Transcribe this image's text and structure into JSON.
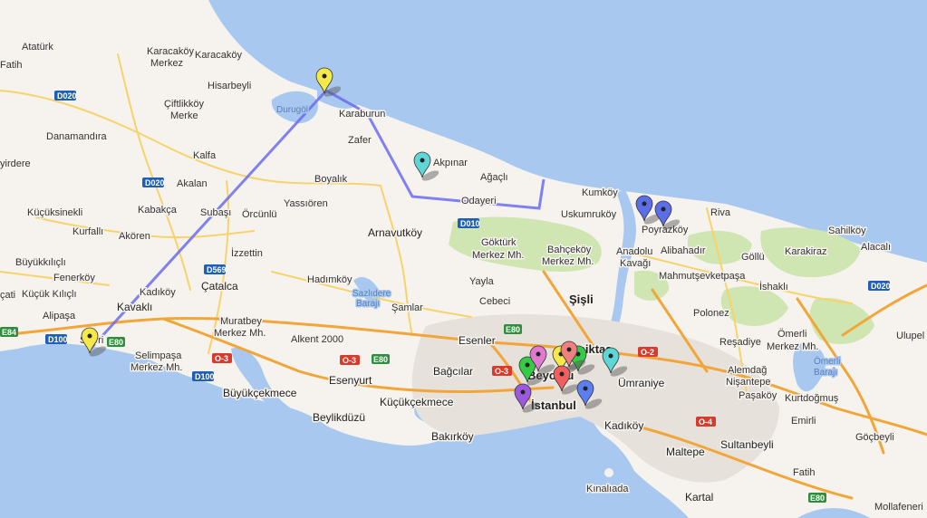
{
  "map": {
    "colors": {
      "sea": "#a8c8f0",
      "land": "#f6f3ee",
      "park": "#cfe6b2",
      "urban": "#e6e1da",
      "route": "#6b6bf0"
    },
    "labels": [
      {
        "id": "ataturk",
        "text": "Atatürk"
      },
      {
        "id": "fatih-w",
        "text": "Fatih"
      },
      {
        "id": "karacakoy-merkez-1",
        "text": "Karacaköy"
      },
      {
        "id": "karacakoy-merkez-2",
        "text": "Merkez"
      },
      {
        "id": "karacakoy",
        "text": "Karacaköy"
      },
      {
        "id": "hisarbeyli",
        "text": "Hisarbeyli"
      },
      {
        "id": "ciftlikkoy-1",
        "text": "Çiftlikköy"
      },
      {
        "id": "ciftlikkoy-2",
        "text": "Merke"
      },
      {
        "id": "durugol",
        "text": "Durugöl"
      },
      {
        "id": "karaburun",
        "text": "Karaburun"
      },
      {
        "id": "zafer",
        "text": "Zafer"
      },
      {
        "id": "danamandira",
        "text": "Danamandıra"
      },
      {
        "id": "yirdere",
        "text": "yirdere"
      },
      {
        "id": "kalfa",
        "text": "Kalfa"
      },
      {
        "id": "boyalik",
        "text": "Boyalık"
      },
      {
        "id": "akpinar",
        "text": "Akpınar"
      },
      {
        "id": "agacli",
        "text": "Ağaçlı"
      },
      {
        "id": "akalan",
        "text": "Akalan"
      },
      {
        "id": "odayeri",
        "text": "Odayeri"
      },
      {
        "id": "kumkoy",
        "text": "Kumköy"
      },
      {
        "id": "kucuksinekli",
        "text": "Küçüksinekli"
      },
      {
        "id": "kabakca",
        "text": "Kabakça"
      },
      {
        "id": "subasi",
        "text": "Subaşı"
      },
      {
        "id": "orcunlu",
        "text": "Örcünlü"
      },
      {
        "id": "yassioren",
        "text": "Yassıören"
      },
      {
        "id": "uskumrukoy",
        "text": "Uskumruköy"
      },
      {
        "id": "poyrazkoy",
        "text": "Poyrazköy"
      },
      {
        "id": "riva",
        "text": "Riva"
      },
      {
        "id": "kurfalli",
        "text": "Kurfallı"
      },
      {
        "id": "akoren",
        "text": "Akören"
      },
      {
        "id": "arnavutkoy",
        "text": "Arnavutköy"
      },
      {
        "id": "gokturk-1",
        "text": "Göktürk"
      },
      {
        "id": "gokturk-2",
        "text": "Merkez Mh."
      },
      {
        "id": "bahcekoy-1",
        "text": "Bahçeköy"
      },
      {
        "id": "bahcekoy-2",
        "text": "Merkez Mh."
      },
      {
        "id": "anadolu-1",
        "text": "Anadolu"
      },
      {
        "id": "anadolu-2",
        "text": "Kavağı"
      },
      {
        "id": "alibahadir",
        "text": "Alibahadır"
      },
      {
        "id": "gollu",
        "text": "Göllü"
      },
      {
        "id": "karakiraz",
        "text": "Karakiraz"
      },
      {
        "id": "sahilkoy",
        "text": "Sahilköy"
      },
      {
        "id": "alacali",
        "text": "Alacalı"
      },
      {
        "id": "izzettin",
        "text": "İzzettin"
      },
      {
        "id": "buyukkilicli",
        "text": "Büyükkılıçlı"
      },
      {
        "id": "fenerkoy",
        "text": "Fenerköy"
      },
      {
        "id": "mahmutsevketpasa",
        "text": "Mahmutşevketpaşa"
      },
      {
        "id": "ishakli",
        "text": "İshaklı"
      },
      {
        "id": "hadimkoy",
        "text": "Hadımköy"
      },
      {
        "id": "yayla",
        "text": "Yayla"
      },
      {
        "id": "sisli",
        "text": "Şişli"
      },
      {
        "id": "kucuk-kilicli",
        "text": "Küçük Kılıçlı"
      },
      {
        "id": "cati",
        "text": "çati"
      },
      {
        "id": "kadikoy-w",
        "text": "Kadıköy"
      },
      {
        "id": "catalca",
        "text": "Çatalca"
      },
      {
        "id": "sazlidere-1",
        "text": "Sazlıdere"
      },
      {
        "id": "sazlidere-2",
        "text": "Barajı"
      },
      {
        "id": "samlar",
        "text": "Şamlar"
      },
      {
        "id": "cebeci",
        "text": "Cebeci"
      },
      {
        "id": "polonez",
        "text": "Polonez"
      },
      {
        "id": "kavakli",
        "text": "Kavaklı"
      },
      {
        "id": "alipasa",
        "text": "Alipaşa"
      },
      {
        "id": "muratbey-1",
        "text": "Muratbey"
      },
      {
        "id": "muratbey-2",
        "text": "Merkez Mh."
      },
      {
        "id": "omerli-1",
        "text": "Ömerli"
      },
      {
        "id": "omerli-2",
        "text": "Merkez Mh."
      },
      {
        "id": "ulupel",
        "text": "Ulupel"
      },
      {
        "id": "silivri",
        "text": "Silivri"
      },
      {
        "id": "alkent",
        "text": "Alkent 2000"
      },
      {
        "id": "esenler",
        "text": "Esenler"
      },
      {
        "id": "besiktas",
        "text": "Beşiktaş"
      },
      {
        "id": "resadiye",
        "text": "Reşadiye"
      },
      {
        "id": "selimpasa-1",
        "text": "Selimpaşa"
      },
      {
        "id": "selimpasa-2",
        "text": "Merkez Mh."
      },
      {
        "id": "bagcilar",
        "text": "Bağcılar"
      },
      {
        "id": "beyoglu",
        "text": "Beyoğlu"
      },
      {
        "id": "umraniye",
        "text": "Ümraniye"
      },
      {
        "id": "alemdag-1",
        "text": "Alemdağ"
      },
      {
        "id": "alemdag-2",
        "text": "Nişantepe"
      },
      {
        "id": "omerli-baraji-1",
        "text": "Ömerli"
      },
      {
        "id": "omerli-baraji-2",
        "text": "Barajı"
      },
      {
        "id": "esenyurt",
        "text": "Esenyurt"
      },
      {
        "id": "buyukcekmece",
        "text": "Büyükçekmece"
      },
      {
        "id": "pasakoy",
        "text": "Paşaköy"
      },
      {
        "id": "kurtdogmus",
        "text": "Kurtdoğmuş"
      },
      {
        "id": "kucukcekmece",
        "text": "Küçükçekmece"
      },
      {
        "id": "istanbul",
        "text": "İstanbul"
      },
      {
        "id": "beylikduzu",
        "text": "Beylikdüzü"
      },
      {
        "id": "kadikoy",
        "text": "Kadıköy"
      },
      {
        "id": "emirli",
        "text": "Emirli"
      },
      {
        "id": "sultanbeyli",
        "text": "Sultanbeyli"
      },
      {
        "id": "gocbeyli",
        "text": "Göçbeyli"
      },
      {
        "id": "maltepe",
        "text": "Maltepe"
      },
      {
        "id": "bakirkoy",
        "text": "Bakırköy"
      },
      {
        "id": "fatih-e",
        "text": "Fatih"
      },
      {
        "id": "kinaliada",
        "text": "Kınalıada"
      },
      {
        "id": "kartal",
        "text": "Kartal"
      },
      {
        "id": "mollafener",
        "text": "Mollafeneri"
      }
    ],
    "shields": [
      {
        "id": "d020-a",
        "text": "D020",
        "kind": "blue"
      },
      {
        "id": "d020-b",
        "text": "D020",
        "kind": "blue"
      },
      {
        "id": "d010",
        "text": "D010",
        "kind": "blue"
      },
      {
        "id": "d569",
        "text": "D569",
        "kind": "blue"
      },
      {
        "id": "e84",
        "text": "E84",
        "kind": "green"
      },
      {
        "id": "d100-a",
        "text": "D100",
        "kind": "blue"
      },
      {
        "id": "e80-a",
        "text": "E80",
        "kind": "green"
      },
      {
        "id": "o3-a",
        "text": "O-3",
        "kind": "red"
      },
      {
        "id": "d100-b",
        "text": "D100",
        "kind": "blue"
      },
      {
        "id": "o3-b",
        "text": "O-3",
        "kind": "red"
      },
      {
        "id": "e80-b",
        "text": "E80",
        "kind": "green"
      },
      {
        "id": "e80-c",
        "text": "E80",
        "kind": "green"
      },
      {
        "id": "o3-c",
        "text": "O-3",
        "kind": "red"
      },
      {
        "id": "o2",
        "text": "O-2",
        "kind": "red"
      },
      {
        "id": "o4",
        "text": "O-4",
        "kind": "red"
      },
      {
        "id": "e80-d",
        "text": "E80",
        "kind": "green"
      },
      {
        "id": "d020-c",
        "text": "D020",
        "kind": "blue"
      }
    ],
    "markers": [
      {
        "id": "marker-yellow-karaburun",
        "color": "#f5e94a"
      },
      {
        "id": "marker-yellow-silivri",
        "color": "#f5e94a"
      },
      {
        "id": "marker-cyan-akpinar",
        "color": "#5fd6d6"
      },
      {
        "id": "marker-blue-poyrazkoy-1",
        "color": "#5b6ee8"
      },
      {
        "id": "marker-blue-poyrazkoy-2",
        "color": "#5b6ee8"
      },
      {
        "id": "marker-green-beyoglu",
        "color": "#33cc44"
      },
      {
        "id": "marker-pink-beyoglu",
        "color": "#e07ad0"
      },
      {
        "id": "marker-yellow-besiktas",
        "color": "#f5e94a"
      },
      {
        "id": "marker-green-besiktas",
        "color": "#33cc44"
      },
      {
        "id": "marker-red-besiktas",
        "color": "#f08080"
      },
      {
        "id": "marker-red-istanbul",
        "color": "#f06060"
      },
      {
        "id": "marker-purple-istanbul",
        "color": "#9b59e0"
      },
      {
        "id": "marker-blue-istanbul",
        "color": "#5b7ef0"
      },
      {
        "id": "marker-cyan-bosphorus",
        "color": "#5fd6d6"
      }
    ]
  }
}
